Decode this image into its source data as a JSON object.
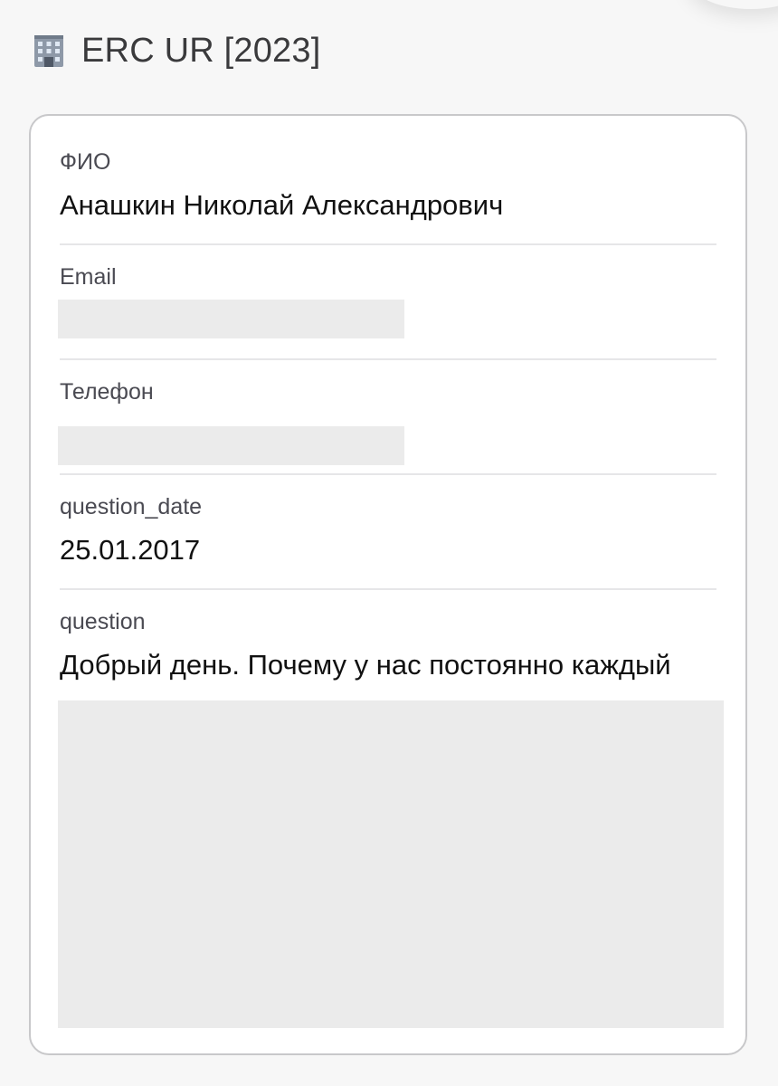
{
  "header": {
    "icon": "office-building-icon",
    "title": "ERC UR [2023]"
  },
  "fields": {
    "fio": {
      "label": "ФИО",
      "value": "Анашкин Николай Александрович"
    },
    "email": {
      "label": "Email"
    },
    "phone": {
      "label": "Телефон"
    },
    "question_date": {
      "label": "question_date",
      "value": "25.01.2017"
    },
    "question": {
      "label": "question",
      "value": "Добрый день. Почему у нас постоянно каждый"
    }
  },
  "colors": {
    "background": "#f7f7f7",
    "card": "#ffffff",
    "card_border": "#c8c8ca",
    "redaction": "#ebebeb",
    "label": "#4a4a52"
  }
}
